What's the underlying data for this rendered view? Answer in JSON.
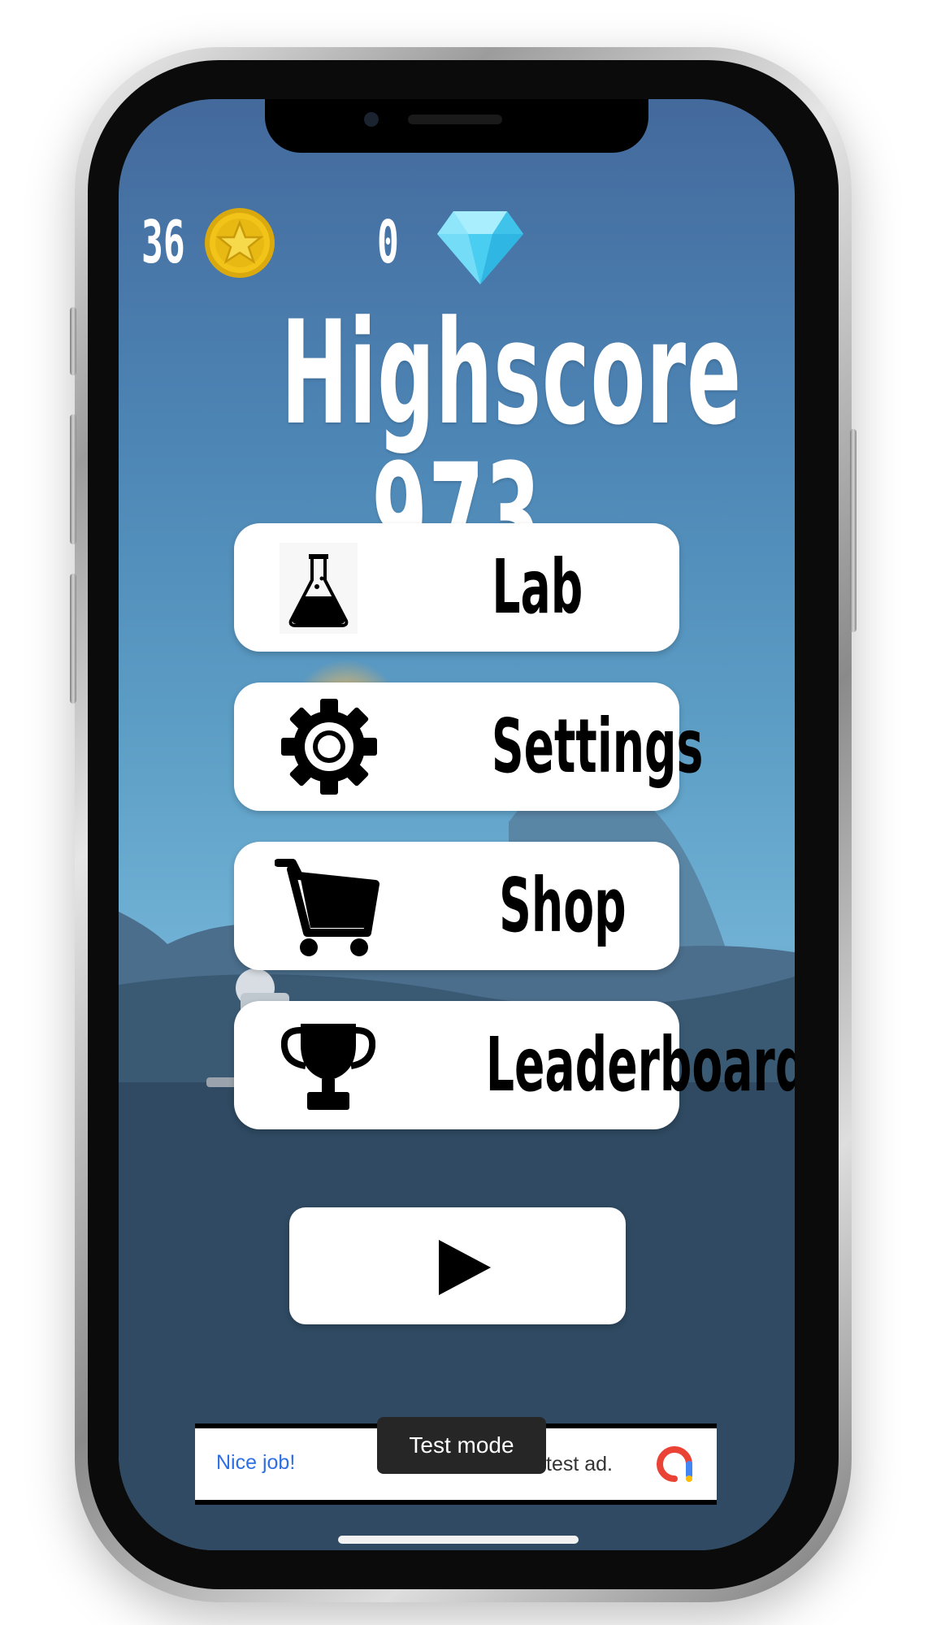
{
  "hud": {
    "coins": "36",
    "gems": "0",
    "coin_icon": "star-coin-icon",
    "gem_icon": "diamond-icon"
  },
  "highscore": {
    "label": "Highscore 973"
  },
  "menu": {
    "items": [
      {
        "label": "Lab",
        "icon": "flask-icon"
      },
      {
        "label": "Settings",
        "icon": "gear-icon"
      },
      {
        "label": "Shop",
        "icon": "cart-icon"
      },
      {
        "label": "Leaderboard",
        "icon": "trophy-icon"
      }
    ]
  },
  "play": {
    "icon": "play-icon"
  },
  "ad": {
    "left_text": "Nice job!",
    "badge": "Test mode",
    "right_text": "test ad.",
    "logo_icon": "admob-icon"
  },
  "colors": {
    "sky_top": "#44699c",
    "sky_mid": "#6fb0d4",
    "ground": "#2d4a63",
    "button_bg": "#ffffff",
    "ad_link": "#2f6fe4",
    "coin": "#f2c419",
    "gem": "#5fd6f5"
  }
}
